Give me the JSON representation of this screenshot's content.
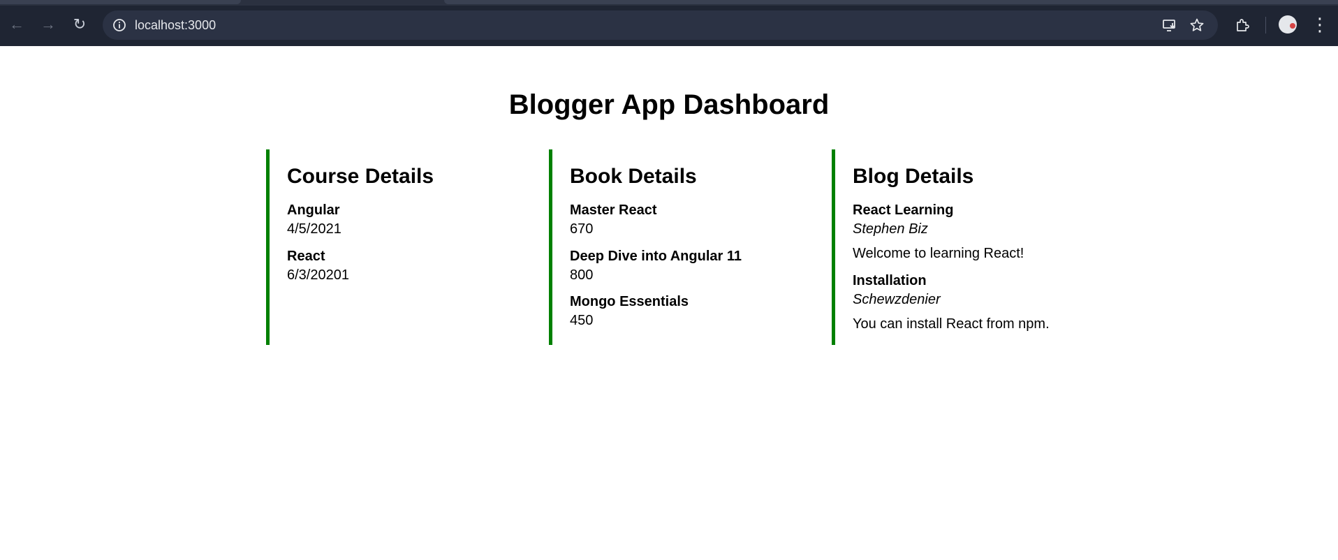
{
  "browser": {
    "url": "localhost:3000",
    "icons": [
      "back-icon",
      "forward-icon",
      "reload-icon",
      "site-info-icon",
      "install-app-icon",
      "bookmark-star-icon",
      "extensions-icon",
      "profile-avatar",
      "menu-icon"
    ],
    "back": "←",
    "forward": "→",
    "reload": "↻",
    "menu": "⋮"
  },
  "page": {
    "title": "Blogger App Dashboard"
  },
  "courses": {
    "heading": "Course Details",
    "items": [
      {
        "name": "Angular",
        "date": "4/5/2021"
      },
      {
        "name": "React",
        "date": "6/3/20201"
      }
    ]
  },
  "books": {
    "heading": "Book Details",
    "items": [
      {
        "name": "Master React",
        "price": "670"
      },
      {
        "name": "Deep Dive into Angular 11",
        "price": "800"
      },
      {
        "name": "Mongo Essentials",
        "price": "450"
      }
    ]
  },
  "blogs": {
    "heading": "Blog Details",
    "items": [
      {
        "title": "React Learning",
        "author": "Stephen Biz",
        "content": "Welcome to learning React!"
      },
      {
        "title": "Installation",
        "author": "Schewzdenier",
        "content": "You can install React from npm."
      }
    ]
  },
  "colors": {
    "accent_border": "#008000",
    "chrome_bg": "#1f2533"
  }
}
